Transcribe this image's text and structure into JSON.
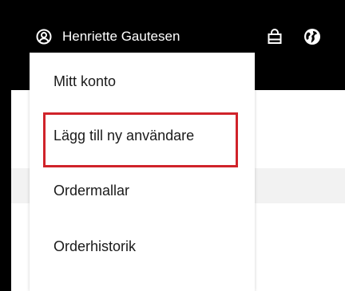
{
  "header": {
    "user_name": "Henriette Gautesen",
    "icons": {
      "user": "user-circle-icon",
      "bag": "shopping-bag-icon",
      "globe": "globe-icon"
    }
  },
  "dropdown": {
    "items": [
      {
        "label": "Mitt konto"
      },
      {
        "label": "Lägg till ny användare",
        "highlighted": true
      },
      {
        "label": "Ordermallar"
      },
      {
        "label": "Orderhistorik"
      }
    ]
  },
  "colors": {
    "header_bg": "#000000",
    "highlight": "#d0232a",
    "menu_text": "#1a1a1a"
  }
}
